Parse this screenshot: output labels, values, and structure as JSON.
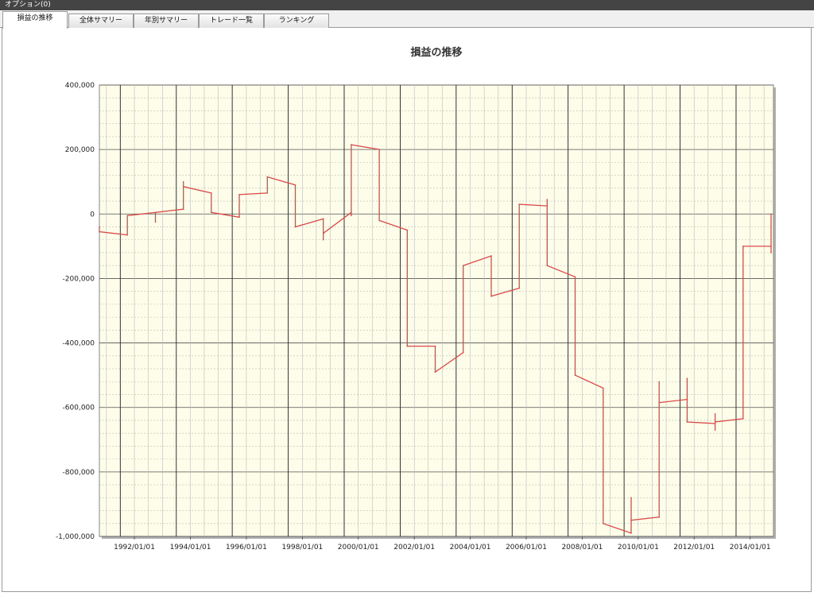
{
  "window": {
    "menu_label": "オプション(0)"
  },
  "tabs": [
    {
      "label": "損益の推移",
      "active": true
    },
    {
      "label": "全体サマリー",
      "active": false
    },
    {
      "label": "年別サマリー",
      "active": false
    },
    {
      "label": "トレード一覧",
      "active": false
    },
    {
      "label": "ランキング",
      "active": false
    }
  ],
  "colors": {
    "line": "#d94a4a",
    "plot_bg": "#fdfde9",
    "major_grid": "#222222",
    "minor_grid": "#bbbbbb"
  },
  "chart_data": {
    "type": "line",
    "title": "損益の推移",
    "xlabel": "",
    "ylabel": "",
    "x_range": [
      "1990/10/01",
      "2014/11/01"
    ],
    "ylim": [
      -1000000,
      400000
    ],
    "y_ticks": [
      400000,
      200000,
      0,
      -200000,
      -400000,
      -600000,
      -800000,
      -1000000
    ],
    "y_tick_labels": [
      "400,000",
      "200,000",
      "0",
      "-200,000",
      "-400,000",
      "-600,000",
      "-800,000",
      "-1,000,000"
    ],
    "x_ticks": [
      "1992/01/01",
      "1994/01/01",
      "1996/01/01",
      "1998/01/01",
      "2000/01/01",
      "2002/01/01",
      "2004/01/01",
      "2006/01/01",
      "2008/01/01",
      "2010/01/01",
      "2012/01/01",
      "2014/01/01"
    ],
    "x_tick_labels": [
      "1992/01/01",
      "1994/01/01",
      "1996/01/01",
      "1998/01/01",
      "2000/01/01",
      "2002/01/01",
      "2004/01/01",
      "2006/01/01",
      "2008/01/01",
      "2010/01/01",
      "2012/01/01",
      "2014/01/01"
    ],
    "major_x_grid": [
      "1991/07/01",
      "1993/07/01",
      "1995/07/01",
      "1997/07/01",
      "1999/07/01",
      "2001/07/01",
      "2003/07/01",
      "2005/07/01",
      "2007/07/01",
      "2009/07/01",
      "2011/07/01",
      "2013/07/01"
    ],
    "grid": true,
    "series": [
      {
        "points": [
          [
            "1990/10/01",
            -40000
          ],
          [
            "1990/10/01",
            -55000
          ],
          [
            "1991/10/01",
            -65000
          ],
          [
            "1991/10/01",
            -5000
          ],
          [
            "1992/10/01",
            5000
          ],
          [
            "1992/10/01",
            -25000
          ],
          [
            "1992/10/01",
            5000
          ],
          [
            "1993/10/01",
            15000
          ],
          [
            "1993/10/01",
            100000
          ],
          [
            "1993/10/01",
            85000
          ],
          [
            "1994/10/01",
            65000
          ],
          [
            "1994/10/01",
            5000
          ],
          [
            "1995/10/01",
            -10000
          ],
          [
            "1995/10/01",
            60000
          ],
          [
            "1996/10/01",
            65000
          ],
          [
            "1996/10/01",
            115000
          ],
          [
            "1997/10/01",
            90000
          ],
          [
            "1997/10/01",
            -40000
          ],
          [
            "1998/10/01",
            -15000
          ],
          [
            "1998/10/01",
            -80000
          ],
          [
            "1998/10/01",
            -60000
          ],
          [
            "1999/10/01",
            5000
          ],
          [
            "1999/10/01",
            -5000
          ],
          [
            "1999/10/01",
            215000
          ],
          [
            "2000/10/01",
            200000
          ],
          [
            "2000/10/01",
            -20000
          ],
          [
            "2001/10/01",
            -50000
          ],
          [
            "2001/10/01",
            -410000
          ],
          [
            "2002/10/01",
            -410000
          ],
          [
            "2002/10/01",
            -490000
          ],
          [
            "2003/10/01",
            -430000
          ],
          [
            "2003/10/01",
            -160000
          ],
          [
            "2004/10/01",
            -130000
          ],
          [
            "2004/10/01",
            -255000
          ],
          [
            "2005/10/01",
            -230000
          ],
          [
            "2005/10/01",
            30000
          ],
          [
            "2006/10/01",
            25000
          ],
          [
            "2006/10/01",
            45000
          ],
          [
            "2006/10/01",
            -160000
          ],
          [
            "2007/10/01",
            -195000
          ],
          [
            "2007/10/01",
            -500000
          ],
          [
            "2008/10/01",
            -540000
          ],
          [
            "2008/10/01",
            -960000
          ],
          [
            "2009/10/01",
            -990000
          ],
          [
            "2009/10/01",
            -880000
          ],
          [
            "2009/10/01",
            -950000
          ],
          [
            "2010/10/01",
            -940000
          ],
          [
            "2010/10/01",
            -520000
          ],
          [
            "2010/10/01",
            -585000
          ],
          [
            "2011/10/01",
            -575000
          ],
          [
            "2011/10/01",
            -510000
          ],
          [
            "2011/10/01",
            -645000
          ],
          [
            "2012/10/01",
            -650000
          ],
          [
            "2012/10/01",
            -620000
          ],
          [
            "2012/10/01",
            -670000
          ],
          [
            "2012/10/01",
            -645000
          ],
          [
            "2013/10/01",
            -635000
          ],
          [
            "2013/10/01",
            -100000
          ],
          [
            "2014/10/01",
            -100000
          ],
          [
            "2014/10/01",
            -120000
          ],
          [
            "2014/10/01",
            0
          ]
        ]
      }
    ]
  }
}
